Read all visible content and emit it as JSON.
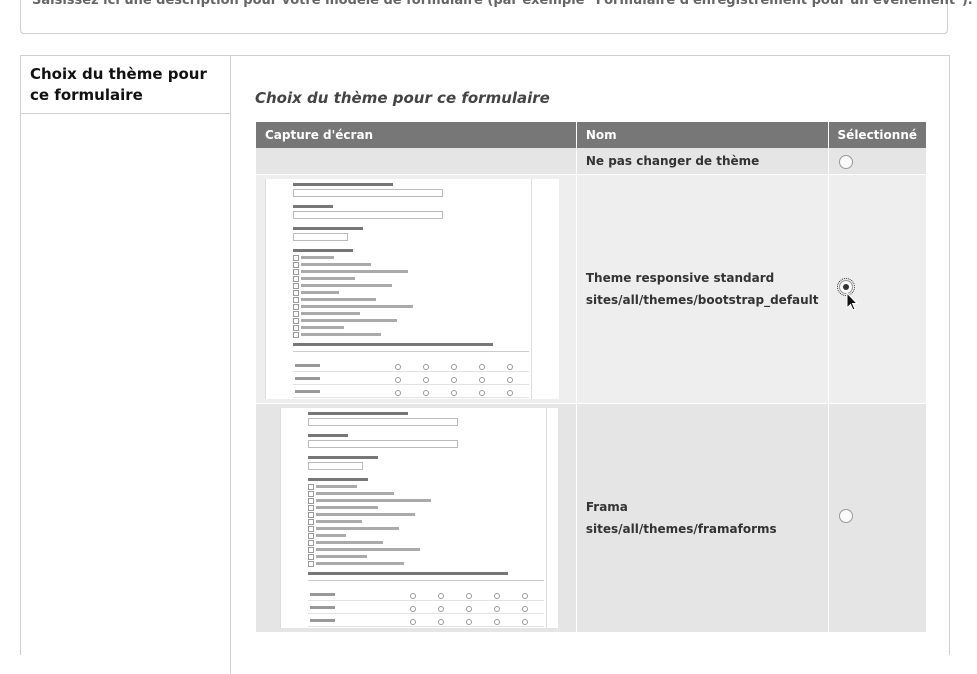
{
  "top": {
    "description": "Saisissez ici une description pour votre modèle de formulaire (par exemple \"Formulaire d'enregistrement pour un évènement\")."
  },
  "theme_section": {
    "tab_label": "Choix du thème pour ce formulaire",
    "legend": "Choix du thème pour ce formulaire",
    "headers": {
      "screenshot": "Capture d'écran",
      "name": "Nom",
      "selected": "Sélectionné"
    },
    "rows": [
      {
        "name": "Ne pas changer de thème",
        "path": "",
        "selected": false
      },
      {
        "name": "Theme responsive standard",
        "path": "sites/all/themes/bootstrap_default",
        "selected": true
      },
      {
        "name": "Frama",
        "path": "sites/all/themes/framaforms",
        "selected": false
      }
    ]
  }
}
